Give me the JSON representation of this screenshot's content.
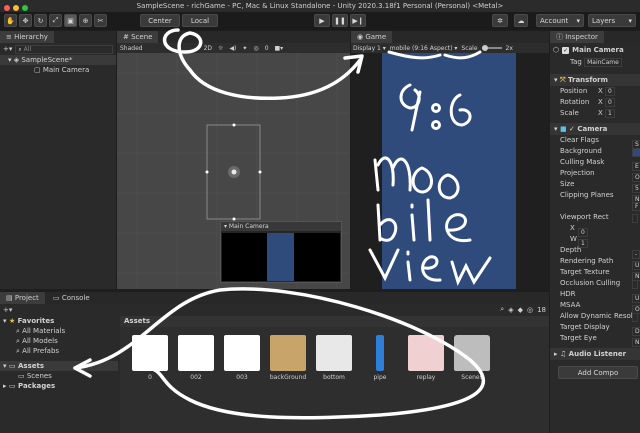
{
  "window": {
    "title": "SampleScene - richGame - PC, Mac & Linux Standalone - Unity 2020.3.18f1 Personal (Personal) <Metal>"
  },
  "toolbar": {
    "pivot_label": "Center",
    "space_label": "Local",
    "account_label": "Account",
    "layers_label": "Layers"
  },
  "hierarchy": {
    "tab_label": "Hierarchy",
    "search_placeholder": "All",
    "scene_name": "SampleScene*",
    "items": [
      "Main Camera"
    ]
  },
  "scene": {
    "tab_label": "Scene",
    "shading_mode": "Shaded",
    "mode_2d": "2D",
    "gizmo_count": "0",
    "preview_title": "Main Camera"
  },
  "game": {
    "tab_label": "Game",
    "display": "Display 1",
    "aspect": "mobile (9:16 Aspect)",
    "scale_label": "Scale",
    "scale_value": "2x",
    "bg_color": "#2f4b7c"
  },
  "inspector": {
    "tab_label": "Inspector",
    "object_name": "Main Camera",
    "tag_label": "Tag",
    "tag_value": "MainCame",
    "transform": {
      "title": "Transform",
      "rows": [
        {
          "label": "Position",
          "axis": "X",
          "value": "0"
        },
        {
          "label": "Rotation",
          "axis": "X",
          "value": "0"
        },
        {
          "label": "Scale",
          "axis": "X",
          "value": "1"
        }
      ]
    },
    "camera": {
      "title": "Camera",
      "rows": [
        {
          "label": "Clear Flags",
          "value": "S"
        },
        {
          "label": "Background",
          "value": ""
        },
        {
          "label": "Culling Mask",
          "value": "E"
        },
        {
          "label": "Projection",
          "value": "O"
        },
        {
          "label": "Size",
          "value": "5"
        },
        {
          "label": "Clipping Planes",
          "value": "N"
        },
        {
          "label": "",
          "value": "F"
        },
        {
          "label": "Viewport Rect",
          "value": ""
        },
        {
          "label": "X",
          "value": "0"
        },
        {
          "label": "W",
          "value": "1"
        },
        {
          "label": "Depth",
          "value": "-"
        },
        {
          "label": "Rendering Path",
          "value": "U"
        },
        {
          "label": "Target Texture",
          "value": "N"
        },
        {
          "label": "Occlusion Culling",
          "value": ""
        },
        {
          "label": "HDR",
          "value": "U"
        },
        {
          "label": "MSAA",
          "value": "O"
        },
        {
          "label": "Allow Dynamic Resol",
          "value": ""
        },
        {
          "label": "Target Display",
          "value": "D"
        },
        {
          "label": "Target Eye",
          "value": "N"
        }
      ]
    },
    "audio_listener": "Audio Listener",
    "add_component": "Add Compo"
  },
  "project": {
    "tab_project": "Project",
    "tab_console": "Console",
    "hidden_count": "18",
    "favorites_label": "Favorites",
    "favorites": [
      "All Materials",
      "All Models",
      "All Prefabs"
    ],
    "assets_label": "Assets",
    "asset_children": [
      "Scenes"
    ],
    "packages_label": "Packages",
    "breadcrumb": "Assets",
    "assets": [
      {
        "name": "0",
        "color": "#ffffff"
      },
      {
        "name": "002",
        "color": "#ffffff"
      },
      {
        "name": "003",
        "color": "#ffffff"
      },
      {
        "name": "backGround",
        "color": "#c9a46a"
      },
      {
        "name": "bottom",
        "color": "#e8e8e8"
      },
      {
        "name": "pipe",
        "color": "#2f7fd8"
      },
      {
        "name": "replay",
        "color": "#f0d0d0"
      },
      {
        "name": "Scenes",
        "color": "#bdbdbd"
      }
    ]
  },
  "annotations": {
    "line1": "9:6",
    "line2": "mo",
    "line3": "bile",
    "line4": "view",
    "color": "#ffffff"
  }
}
